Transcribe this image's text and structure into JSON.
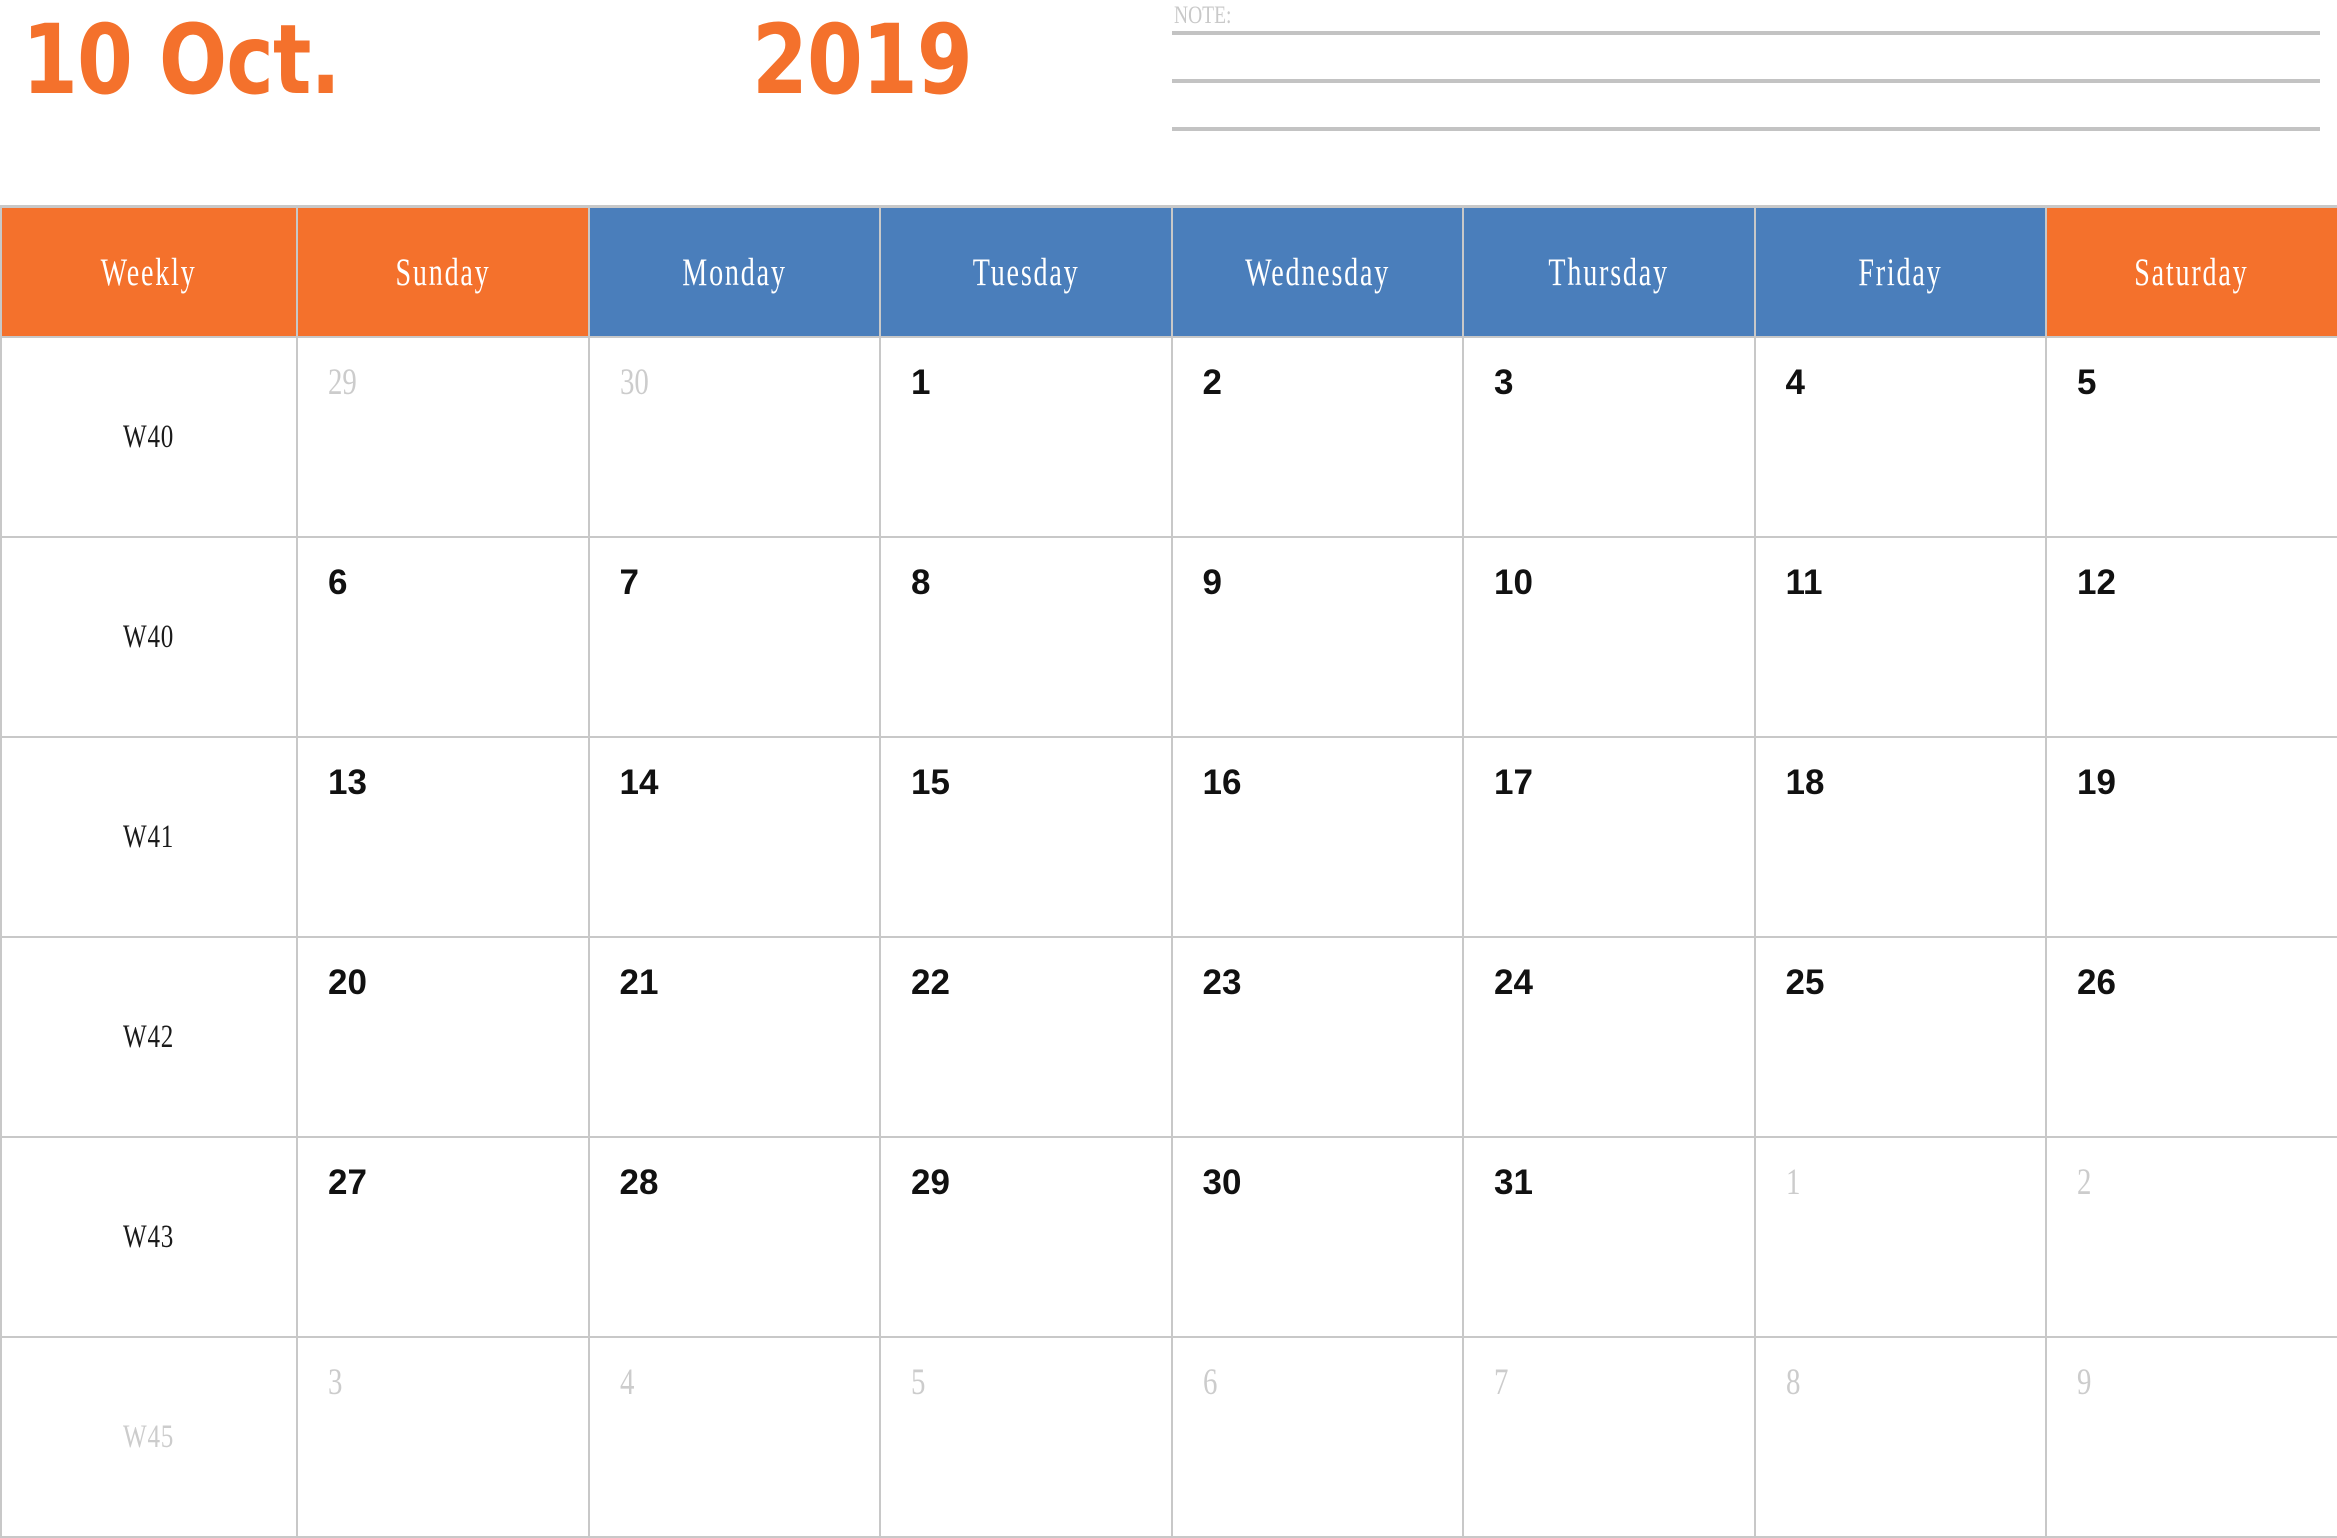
{
  "header": {
    "month_title": "10 Oct.",
    "year_title": "2019",
    "accent_color": "#F4712C",
    "weekday_color": "#4A7EBB",
    "note": {
      "label": "NOTE:",
      "line_count": 3
    }
  },
  "calendar": {
    "columns": [
      {
        "label": "Weekly",
        "type": "week"
      },
      {
        "label": "Sunday",
        "type": "weekend"
      },
      {
        "label": "Monday",
        "type": "weekday"
      },
      {
        "label": "Tuesday",
        "type": "weekday"
      },
      {
        "label": "Wednesday",
        "type": "weekday"
      },
      {
        "label": "Thursday",
        "type": "weekday"
      },
      {
        "label": "Friday",
        "type": "weekday"
      },
      {
        "label": "Saturday",
        "type": "weekend"
      }
    ],
    "rows": [
      {
        "week": "W40",
        "week_dim": false,
        "days": [
          {
            "n": "29",
            "other": true
          },
          {
            "n": "30",
            "other": true
          },
          {
            "n": "1",
            "other": false
          },
          {
            "n": "2",
            "other": false
          },
          {
            "n": "3",
            "other": false
          },
          {
            "n": "4",
            "other": false
          },
          {
            "n": "5",
            "other": false
          }
        ]
      },
      {
        "week": "W40",
        "week_dim": false,
        "days": [
          {
            "n": "6",
            "other": false
          },
          {
            "n": "7",
            "other": false
          },
          {
            "n": "8",
            "other": false
          },
          {
            "n": "9",
            "other": false
          },
          {
            "n": "10",
            "other": false
          },
          {
            "n": "11",
            "other": false
          },
          {
            "n": "12",
            "other": false
          }
        ]
      },
      {
        "week": "W41",
        "week_dim": false,
        "days": [
          {
            "n": "13",
            "other": false
          },
          {
            "n": "14",
            "other": false
          },
          {
            "n": "15",
            "other": false
          },
          {
            "n": "16",
            "other": false
          },
          {
            "n": "17",
            "other": false
          },
          {
            "n": "18",
            "other": false
          },
          {
            "n": "19",
            "other": false
          }
        ]
      },
      {
        "week": "W42",
        "week_dim": false,
        "days": [
          {
            "n": "20",
            "other": false
          },
          {
            "n": "21",
            "other": false
          },
          {
            "n": "22",
            "other": false
          },
          {
            "n": "23",
            "other": false
          },
          {
            "n": "24",
            "other": false
          },
          {
            "n": "25",
            "other": false
          },
          {
            "n": "26",
            "other": false
          }
        ]
      },
      {
        "week": "W43",
        "week_dim": false,
        "days": [
          {
            "n": "27",
            "other": false
          },
          {
            "n": "28",
            "other": false
          },
          {
            "n": "29",
            "other": false
          },
          {
            "n": "30",
            "other": false
          },
          {
            "n": "31",
            "other": false
          },
          {
            "n": "1",
            "other": true
          },
          {
            "n": "2",
            "other": true
          }
        ]
      },
      {
        "week": "W45",
        "week_dim": true,
        "days": [
          {
            "n": "3",
            "other": true
          },
          {
            "n": "4",
            "other": true
          },
          {
            "n": "5",
            "other": true
          },
          {
            "n": "6",
            "other": true
          },
          {
            "n": "7",
            "other": true
          },
          {
            "n": "8",
            "other": true
          },
          {
            "n": "9",
            "other": true
          }
        ]
      }
    ]
  }
}
